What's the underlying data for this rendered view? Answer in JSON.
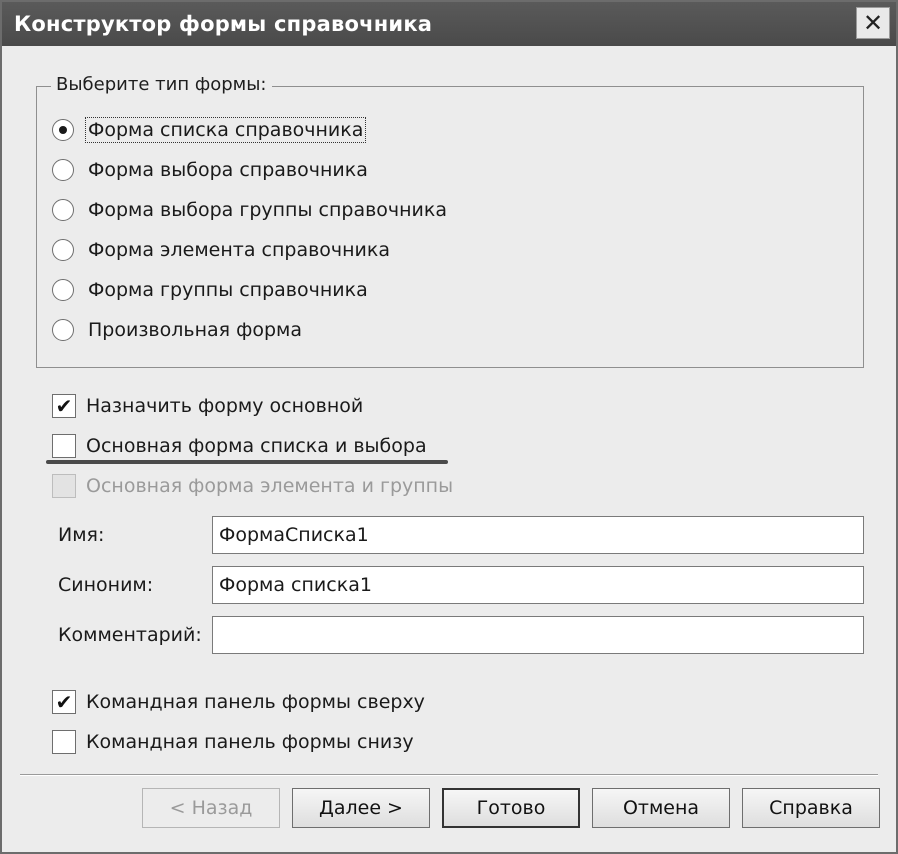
{
  "window": {
    "title": "Конструктор формы справочника",
    "close_glyph": "✕"
  },
  "form_type_group": {
    "legend": "Выберите тип формы:",
    "options": [
      {
        "label": "Форма списка справочника",
        "selected": true
      },
      {
        "label": "Форма выбора справочника",
        "selected": false
      },
      {
        "label": "Форма выбора группы справочника",
        "selected": false
      },
      {
        "label": "Форма элемента справочника",
        "selected": false
      },
      {
        "label": "Форма группы справочника",
        "selected": false
      },
      {
        "label": "Произвольная форма",
        "selected": false
      }
    ]
  },
  "checks": {
    "set_main": {
      "label": "Назначить форму основной",
      "checked": true,
      "enabled": true
    },
    "main_list_choice": {
      "label": "Основная форма списка и выбора",
      "checked": false,
      "enabled": true
    },
    "main_element_group": {
      "label": "Основная форма элемента и группы",
      "checked": false,
      "enabled": false
    },
    "cmd_top": {
      "label": "Командная панель формы сверху",
      "checked": true,
      "enabled": true
    },
    "cmd_bottom": {
      "label": "Командная панель формы снизу",
      "checked": false,
      "enabled": true
    }
  },
  "fields": {
    "name": {
      "label": "Имя:",
      "value": "ФормаСписка1"
    },
    "synonym": {
      "label": "Синоним:",
      "value": "Форма списка1"
    },
    "comment": {
      "label": "Комментарий:",
      "value": ""
    }
  },
  "buttons": {
    "back": "< Назад",
    "next": "Далее >",
    "done": "Готово",
    "cancel": "Отмена",
    "help": "Справка"
  },
  "icons": {
    "close": "close-icon",
    "radio_selected": "radio-dot-icon",
    "check": "checkmark-icon"
  },
  "check_glyph": "✔"
}
